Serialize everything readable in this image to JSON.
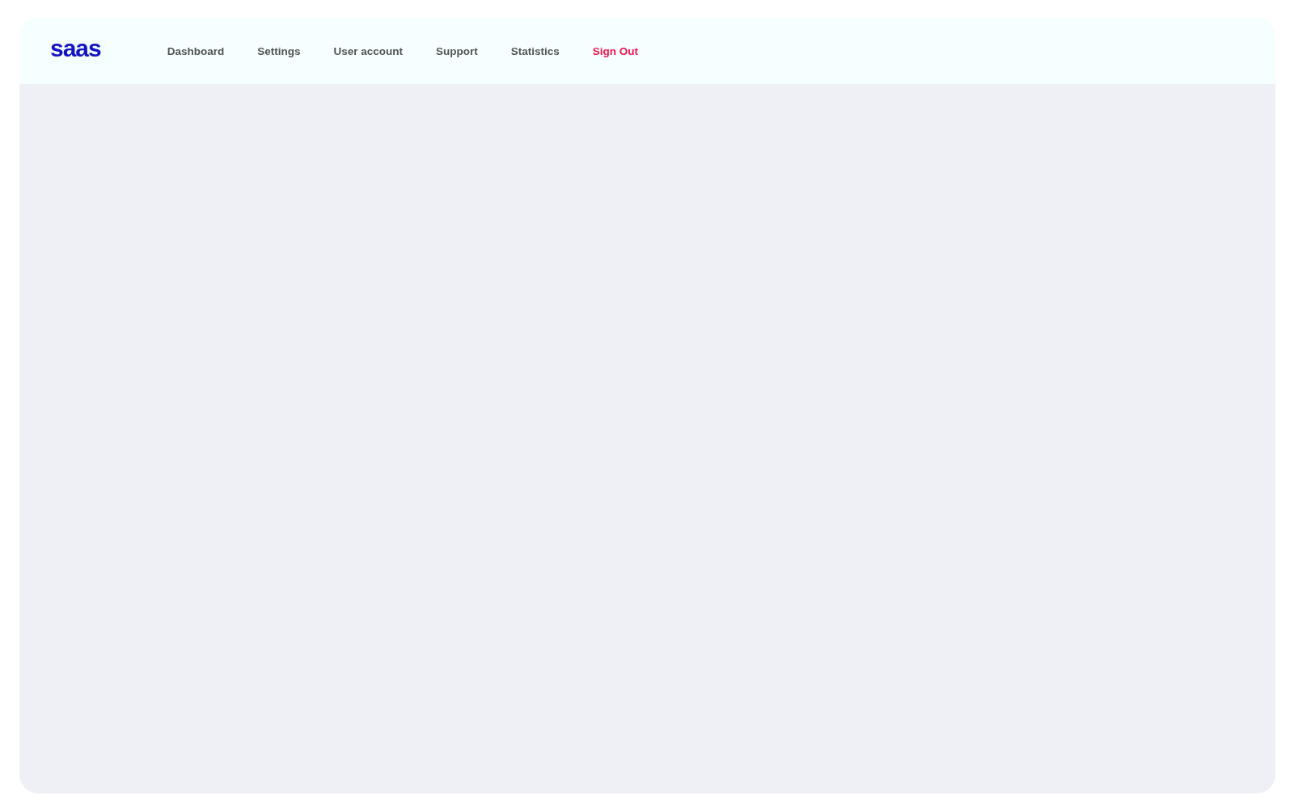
{
  "header": {
    "logo": "saas",
    "nav": [
      {
        "label": "Dashboard",
        "kind": "link"
      },
      {
        "label": "Settings",
        "kind": "link"
      },
      {
        "label": "User account",
        "kind": "link"
      },
      {
        "label": "Support",
        "kind": "link"
      },
      {
        "label": "Statistics",
        "kind": "link"
      },
      {
        "label": "Sign Out",
        "kind": "signout"
      }
    ]
  }
}
